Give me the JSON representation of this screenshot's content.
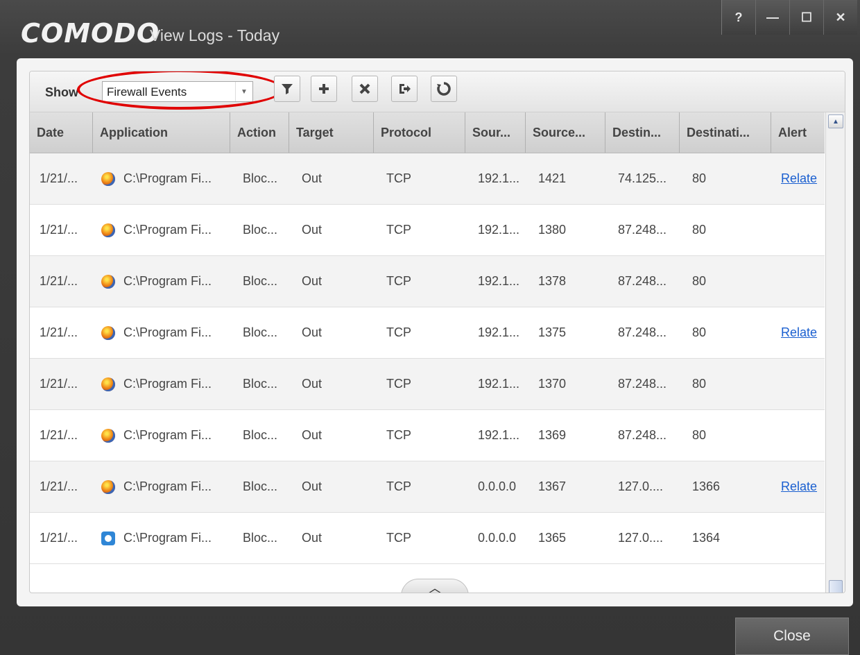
{
  "titlebar": {
    "logo": "COMODO",
    "title": "View Logs - Today",
    "help_label": "?",
    "minimize_label": "—",
    "maximize_label": "☐",
    "close_label": "✕"
  },
  "toolbar": {
    "show_label": "Show",
    "event_type_value": "Firewall Events",
    "dropdown_arrow": "▼",
    "filter_icon": "filter-icon",
    "add_icon": "plus-icon",
    "remove_icon": "x-icon",
    "export_icon": "export-icon",
    "refresh_icon": "refresh-icon"
  },
  "table": {
    "columns": [
      "Date",
      "Application",
      "Action",
      "Target",
      "Protocol",
      "Sour...",
      "Source...",
      "Destin...",
      "Destinati...",
      "Alert"
    ],
    "rows": [
      {
        "date": "1/21/...",
        "icon": "firefox-icon",
        "application": "C:\\Program Fi...",
        "action": "Bloc...",
        "target": "Out",
        "protocol": "TCP",
        "source_ip": "192.1...",
        "source_port": "1421",
        "dest_ip": "74.125...",
        "dest_port": "80",
        "alert": "Relate"
      },
      {
        "date": "1/21/...",
        "icon": "firefox-icon",
        "application": "C:\\Program Fi...",
        "action": "Bloc...",
        "target": "Out",
        "protocol": "TCP",
        "source_ip": "192.1...",
        "source_port": "1380",
        "dest_ip": "87.248...",
        "dest_port": "80",
        "alert": ""
      },
      {
        "date": "1/21/...",
        "icon": "firefox-icon",
        "application": "C:\\Program Fi...",
        "action": "Bloc...",
        "target": "Out",
        "protocol": "TCP",
        "source_ip": "192.1...",
        "source_port": "1378",
        "dest_ip": "87.248...",
        "dest_port": "80",
        "alert": ""
      },
      {
        "date": "1/21/...",
        "icon": "firefox-icon",
        "application": "C:\\Program Fi...",
        "action": "Bloc...",
        "target": "Out",
        "protocol": "TCP",
        "source_ip": "192.1...",
        "source_port": "1375",
        "dest_ip": "87.248...",
        "dest_port": "80",
        "alert": "Relate"
      },
      {
        "date": "1/21/...",
        "icon": "firefox-icon",
        "application": "C:\\Program Fi...",
        "action": "Bloc...",
        "target": "Out",
        "protocol": "TCP",
        "source_ip": "192.1...",
        "source_port": "1370",
        "dest_ip": "87.248...",
        "dest_port": "80",
        "alert": ""
      },
      {
        "date": "1/21/...",
        "icon": "firefox-icon",
        "application": "C:\\Program Fi...",
        "action": "Bloc...",
        "target": "Out",
        "protocol": "TCP",
        "source_ip": "192.1...",
        "source_port": "1369",
        "dest_ip": "87.248...",
        "dest_port": "80",
        "alert": ""
      },
      {
        "date": "1/21/...",
        "icon": "firefox-icon",
        "application": "C:\\Program Fi...",
        "action": "Bloc...",
        "target": "Out",
        "protocol": "TCP",
        "source_ip": "0.0.0.0",
        "source_port": "1367",
        "dest_ip": "127.0....",
        "dest_port": "1366",
        "alert": "Relate"
      },
      {
        "date": "1/21/...",
        "icon": "teamviewer-icon",
        "application": "C:\\Program Fi...",
        "action": "Bloc...",
        "target": "Out",
        "protocol": "TCP",
        "source_ip": "0.0.0.0",
        "source_port": "1365",
        "dest_ip": "127.0....",
        "dest_port": "1364",
        "alert": ""
      }
    ]
  },
  "scrollbar": {
    "up_arrow": "▲",
    "down_arrow": "▼"
  },
  "collapse_label": "︿",
  "footer": {
    "close_label": "Close"
  }
}
